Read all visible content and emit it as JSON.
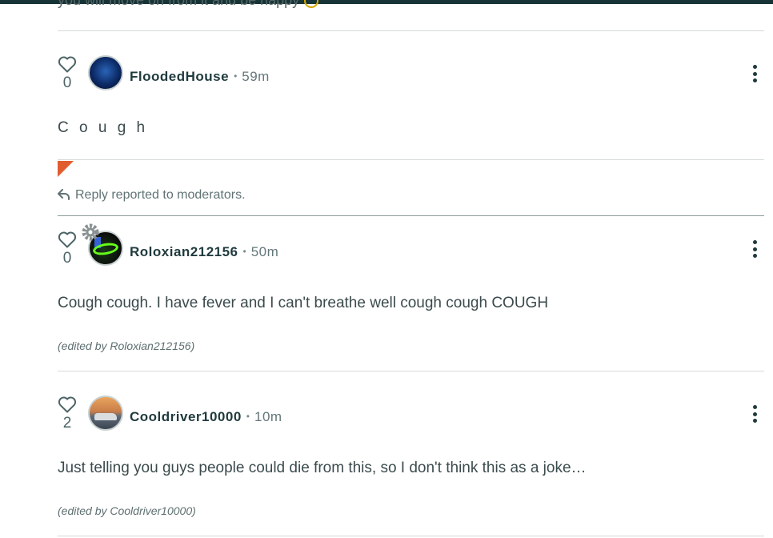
{
  "previous_comment": {
    "tail_text": "you will move on from it and be happy"
  },
  "comments": [
    {
      "username": "FloodedHouse",
      "time": "59m",
      "likes": "0",
      "text": "C o u g h",
      "edited": "",
      "reported": true,
      "reported_text": "Reply reported to moderators."
    },
    {
      "username": "Roloxian212156",
      "time": "50m",
      "likes": "0",
      "text": "Cough cough. I have fever and I can't breathe well cough cough COUGH",
      "edited": "(edited by Roloxian212156)"
    },
    {
      "username": "Cooldriver10000",
      "time": "10m",
      "likes": "2",
      "text": "Just telling you guys people could die from this, so I don't think this as a joke…",
      "edited": "(edited by Cooldriver10000)"
    }
  ],
  "colors": {
    "accent_flag": "#e05d2e",
    "text_primary": "#1f3a3d",
    "top_bar": "#163336"
  },
  "icons": {
    "like": "heart-outline-icon",
    "menu": "kebab-menu-icon",
    "reply": "reply-arrow-icon",
    "badge": "gear-badge-icon"
  }
}
